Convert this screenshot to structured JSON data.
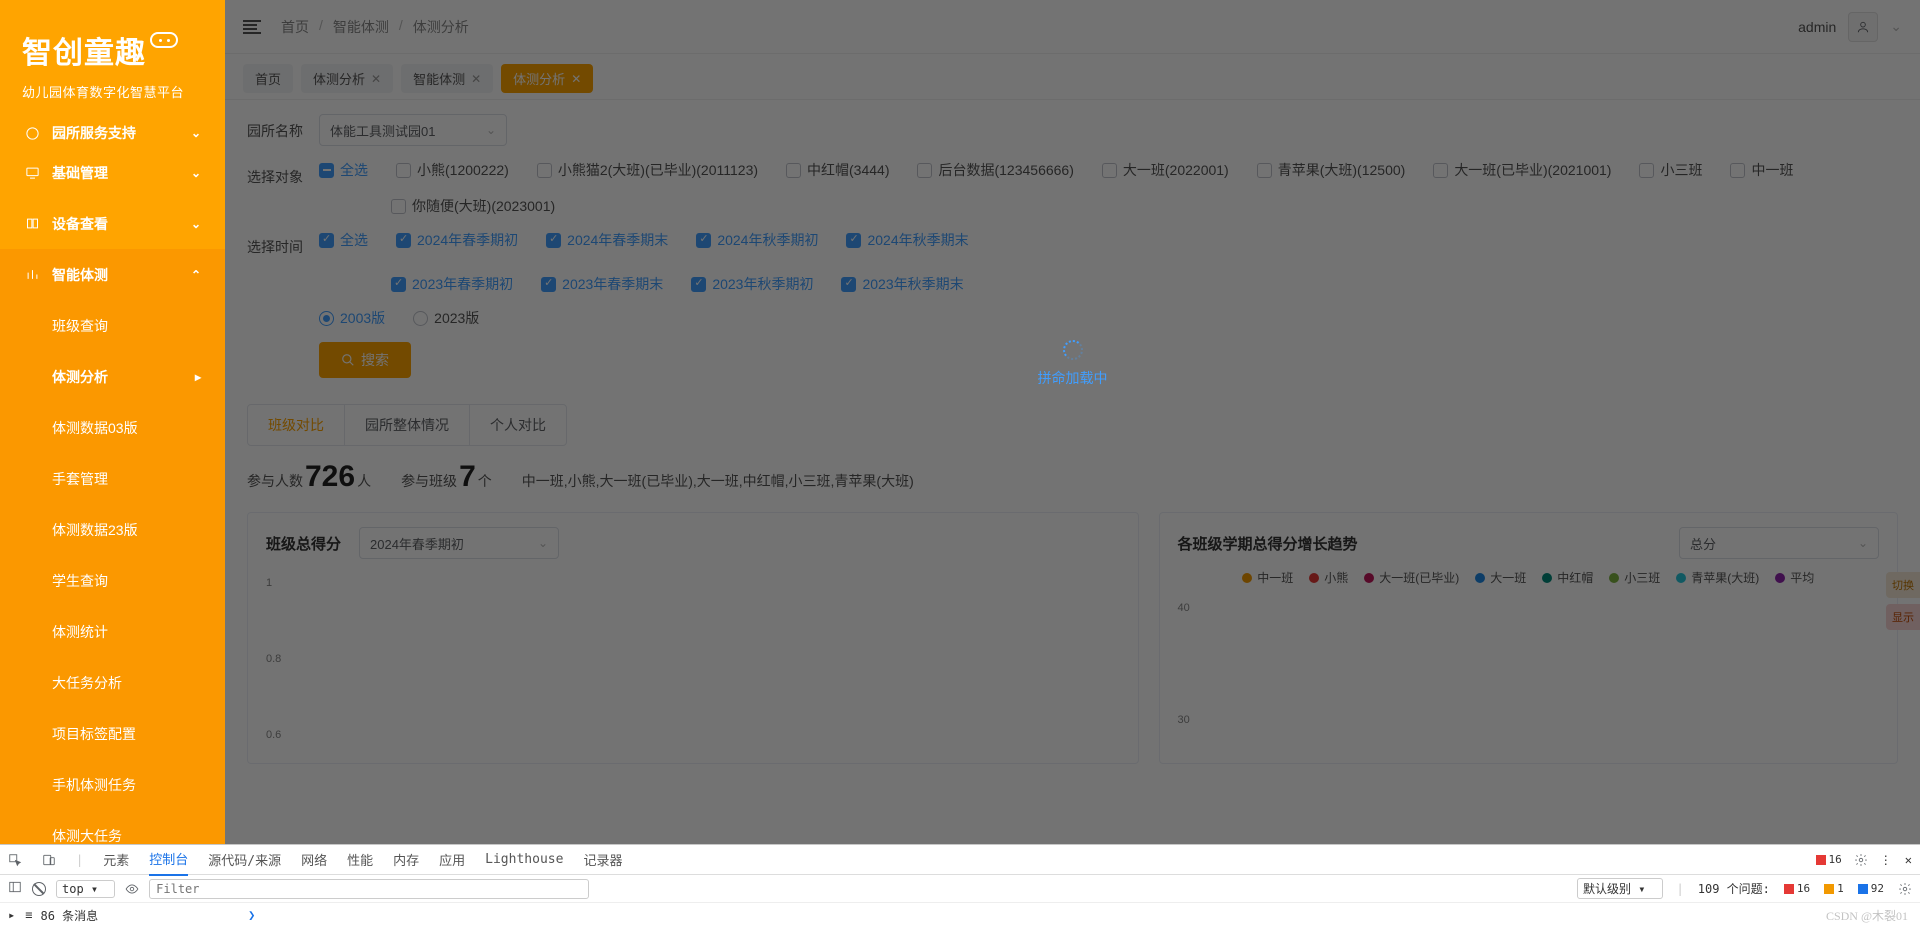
{
  "brand": {
    "name": "智创童趣",
    "subtitle": "幼儿园体育数字化智慧平台"
  },
  "sidebar": {
    "truncated_item": "园所服务支持",
    "items": [
      {
        "label": "基础管理",
        "open": false
      },
      {
        "label": "设备查看",
        "open": false
      },
      {
        "label": "智能体测",
        "open": true
      }
    ],
    "sub_items": [
      {
        "label": "班级查询",
        "active": false
      },
      {
        "label": "体测分析",
        "active": true
      },
      {
        "label": "体测数据03版",
        "active": false
      },
      {
        "label": "手套管理",
        "active": false
      },
      {
        "label": "体测数据23版",
        "active": false
      },
      {
        "label": "学生查询",
        "active": false
      },
      {
        "label": "体测统计",
        "active": false
      },
      {
        "label": "大任务分析",
        "active": false
      },
      {
        "label": "项目标签配置",
        "active": false
      },
      {
        "label": "手机体测任务",
        "active": false
      },
      {
        "label": "体测大任务",
        "active": false
      }
    ]
  },
  "topbar": {
    "breadcrumbs": [
      "首页",
      "智能体测",
      "体测分析"
    ],
    "user": "admin"
  },
  "tabs": [
    {
      "label": "首页",
      "closable": false,
      "active": false
    },
    {
      "label": "体测分析",
      "closable": true,
      "active": false
    },
    {
      "label": "智能体测",
      "closable": true,
      "active": false
    },
    {
      "label": "体测分析",
      "closable": true,
      "active": true
    }
  ],
  "form": {
    "garden_label": "园所名称",
    "garden_value": "体能工具测试园01",
    "object_label": "选择对象",
    "all_label": "全选",
    "objects": [
      {
        "label": "小熊(1200222)",
        "checked": false
      },
      {
        "label": "小熊猫2(大班)(已毕业)(2011123)",
        "checked": false
      },
      {
        "label": "中红帽(3444)",
        "checked": false
      },
      {
        "label": "后台数据(123456666)",
        "checked": false
      },
      {
        "label": "大一班(2022001)",
        "checked": false
      },
      {
        "label": "青苹果(大班)(12500)",
        "checked": false
      },
      {
        "label": "大一班(已毕业)(2021001)",
        "checked": false
      },
      {
        "label": "小三班",
        "checked": false
      },
      {
        "label": "中一班",
        "checked": false
      },
      {
        "label": "你随便(大班)(2023001)",
        "checked": false
      }
    ],
    "time_label": "选择时间",
    "times": [
      {
        "label": "2024年春季期初",
        "checked": true
      },
      {
        "label": "2024年春季期末",
        "checked": true
      },
      {
        "label": "2024年秋季期初",
        "checked": true
      },
      {
        "label": "2024年秋季期末",
        "checked": true
      },
      {
        "label": "2023年春季期初",
        "checked": true
      },
      {
        "label": "2023年春季期末",
        "checked": true
      },
      {
        "label": "2023年秋季期初",
        "checked": true
      },
      {
        "label": "2023年秋季期末",
        "checked": true
      }
    ],
    "versions": [
      {
        "label": "2003版",
        "checked": true
      },
      {
        "label": "2023版",
        "checked": false
      }
    ],
    "search_button": "搜索"
  },
  "view_tabs": [
    "班级对比",
    "园所整体情况",
    "个人对比"
  ],
  "summary": {
    "people_label": "参与人数",
    "people_value": "726",
    "people_unit": "人",
    "class_label": "参与班级",
    "class_value": "7",
    "class_unit": "个",
    "class_list": "中一班,小熊,大一班(已毕业),大一班,中红帽,小三班,青苹果(大班)"
  },
  "panel_left": {
    "title": "班级总得分",
    "term_select": "2024年春季期初",
    "y_ticks": [
      "1",
      "0.8",
      "0.6"
    ]
  },
  "panel_right": {
    "title": "各班级学期总得分增长趋势",
    "score_select": "总分",
    "y_ticks": [
      "40",
      "30"
    ],
    "legend": [
      {
        "name": "中一班",
        "color": "#f29900"
      },
      {
        "name": "小熊",
        "color": "#e53935"
      },
      {
        "name": "大一班(已毕业)",
        "color": "#c2185b"
      },
      {
        "name": "大一班",
        "color": "#1e88e5"
      },
      {
        "name": "中红帽",
        "color": "#00897b"
      },
      {
        "name": "小三班",
        "color": "#7cb342"
      },
      {
        "name": "青苹果(大班)",
        "color": "#26c6da"
      },
      {
        "name": "平均",
        "color": "#8e24aa"
      }
    ]
  },
  "side_buttons": [
    "切换",
    "显示"
  ],
  "loading_text": "拼命加载中",
  "chart_data": [
    {
      "type": "bar",
      "title": "班级总得分",
      "ylabel": "",
      "ylim": [
        0,
        1
      ],
      "y_ticks": [
        1,
        0.8,
        0.6
      ],
      "categories": [],
      "values": [],
      "note": "chart visible axis only; bars not yet rendered (loading overlay)"
    },
    {
      "type": "line",
      "title": "各班级学期总得分增长趋势",
      "ylim": [
        30,
        40
      ],
      "y_ticks": [
        40,
        30
      ],
      "series": [
        {
          "name": "中一班"
        },
        {
          "name": "小熊"
        },
        {
          "name": "大一班(已毕业)"
        },
        {
          "name": "大一班"
        },
        {
          "name": "中红帽"
        },
        {
          "name": "小三班"
        },
        {
          "name": "青苹果(大班)"
        },
        {
          "name": "平均"
        }
      ],
      "note": "lines not yet rendered (loading overlay)"
    }
  ],
  "devtools": {
    "tabs": [
      "元素",
      "控制台",
      "源代码/来源",
      "网络",
      "性能",
      "内存",
      "应用",
      "Lighthouse",
      "记录器"
    ],
    "active_tab": "控制台",
    "errors": "16",
    "top_context": "top",
    "filter_placeholder": "Filter",
    "level_label": "默认级别",
    "issues_label": "109 个问题:",
    "issues": {
      "errors": "16",
      "warnings": "1",
      "info": "92"
    },
    "message_count": "86 条消息",
    "watermark": "CSDN @木裂01"
  }
}
